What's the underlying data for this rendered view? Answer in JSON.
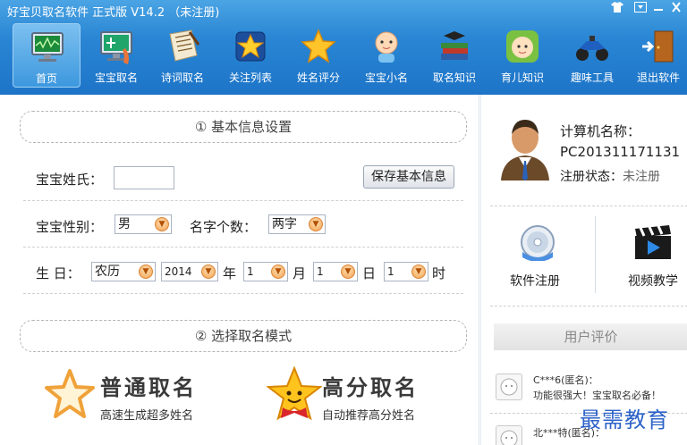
{
  "window": {
    "title": "好宝贝取名软件  正式版 V14.2 （未注册)",
    "controls": [
      "shirt-icon",
      "menu-icon",
      "minimize-icon",
      "close-icon"
    ]
  },
  "toolbar": {
    "items": [
      {
        "label": "首页",
        "icon": "monitor-icon"
      },
      {
        "label": "宝宝取名",
        "icon": "monitor-brush-icon"
      },
      {
        "label": "诗词取名",
        "icon": "scroll-icon"
      },
      {
        "label": "关注列表",
        "icon": "star-box-icon"
      },
      {
        "label": "姓名评分",
        "icon": "star-icon"
      },
      {
        "label": "宝宝小名",
        "icon": "baby-icon"
      },
      {
        "label": "取名知识",
        "icon": "books-icon"
      },
      {
        "label": "育儿知识",
        "icon": "baby-face-icon"
      },
      {
        "label": "趣味工具",
        "icon": "atv-icon"
      },
      {
        "label": "退出软件",
        "icon": "door-exit-icon"
      }
    ]
  },
  "basic": {
    "heading": "① 基本信息设置",
    "surname_label": "宝宝姓氏：",
    "surname_value": "",
    "save_label": "保存基本信息",
    "gender_label": "宝宝性别：",
    "gender_value": "男",
    "count_label": "名字个数：",
    "count_value": "两字",
    "birth_label": "生 日：",
    "calendar_value": "农历",
    "year_value": "2014",
    "year_unit": "年",
    "month_value": "1",
    "month_unit": "月",
    "day_value": "1",
    "day_unit": "日",
    "hour_value": "1",
    "hour_unit": "时"
  },
  "mode": {
    "heading": "② 选择取名模式",
    "normal_title": "普通取名",
    "normal_sub": "高速生成超多姓名",
    "high_title": "高分取名",
    "high_sub": "自动推荐高分姓名"
  },
  "user": {
    "pc_label": "计算机名称：",
    "pc_name": "PC201311171131",
    "reg_label": "注册状态：",
    "reg_value": "未注册",
    "register_label": "软件注册",
    "video_label": "视频教学"
  },
  "reviews": {
    "heading": "用户评价",
    "items": [
      {
        "name": "C***6(匿名)：",
        "text": "功能很强大！宝宝取名必备！"
      },
      {
        "name": "北***特(匿名)：",
        "text": ""
      }
    ]
  },
  "watermark": "最需教育",
  "colors": {
    "header_top": "#4aa4e4",
    "header_bottom": "#1d74c8",
    "accent_orange": "#f3a04a",
    "watermark_blue": "#2d63c8"
  }
}
